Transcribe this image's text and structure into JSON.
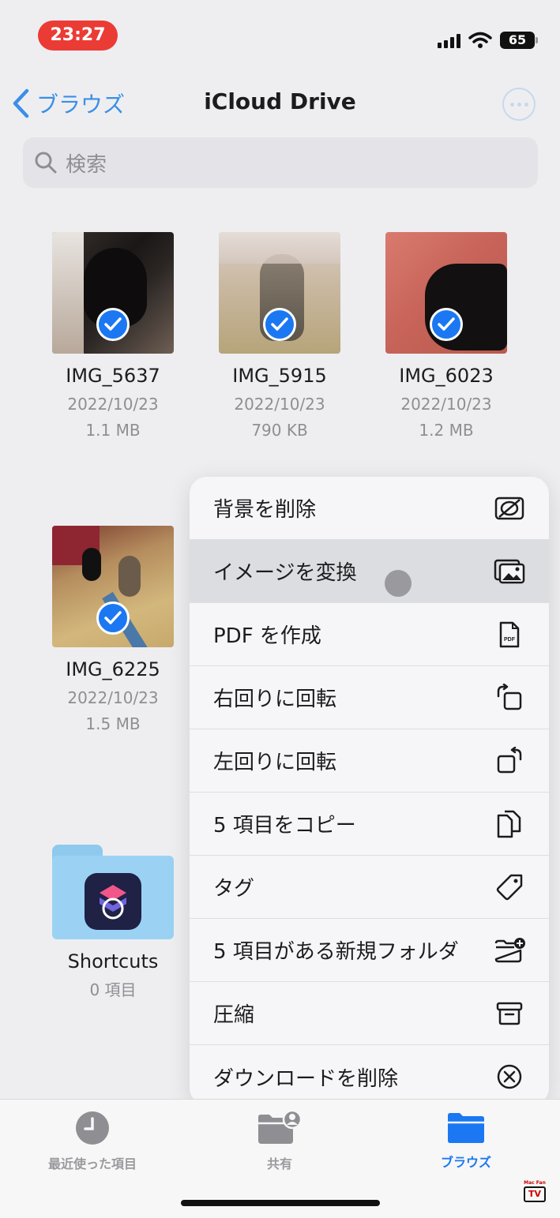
{
  "status_bar": {
    "time": "23:27",
    "battery": "65"
  },
  "nav": {
    "back_label": "ブラウズ",
    "title": "iCloud Drive"
  },
  "search": {
    "placeholder": "検索"
  },
  "files": [
    {
      "name": "IMG_5637",
      "date": "2022/10/23",
      "size": "1.1 MB"
    },
    {
      "name": "IMG_5915",
      "date": "2022/10/23",
      "size": "790 KB"
    },
    {
      "name": "IMG_6023",
      "date": "2022/10/23",
      "size": "1.2 MB"
    },
    {
      "name": "IMG_6225",
      "date": "2022/10/23",
      "size": "1.5 MB"
    }
  ],
  "folder": {
    "name": "Shortcuts",
    "count": "0 項目"
  },
  "menu": {
    "items": [
      {
        "label": "背景を削除",
        "icon": "remove-background-icon"
      },
      {
        "label": "イメージを変換",
        "icon": "convert-image-icon"
      },
      {
        "label": "PDF を作成",
        "icon": "pdf-icon"
      },
      {
        "label": "右回りに回転",
        "icon": "rotate-right-icon"
      },
      {
        "label": "左回りに回転",
        "icon": "rotate-left-icon"
      },
      {
        "label": "5 項目をコピー",
        "icon": "copy-icon"
      },
      {
        "label": "タグ",
        "icon": "tag-icon"
      },
      {
        "label": "5 項目がある新規フォルダ",
        "icon": "new-folder-icon"
      },
      {
        "label": "圧縮",
        "icon": "archive-icon"
      },
      {
        "label": "ダウンロードを削除",
        "icon": "remove-download-icon"
      }
    ]
  },
  "tabbar": {
    "recents": "最近使った項目",
    "shared": "共有",
    "browse": "ブラウズ"
  },
  "watermark": {
    "top": "Mac Fan",
    "box": "TV"
  },
  "colors": {
    "accent": "#1b78f2",
    "time_pill": "#eb3b35"
  }
}
